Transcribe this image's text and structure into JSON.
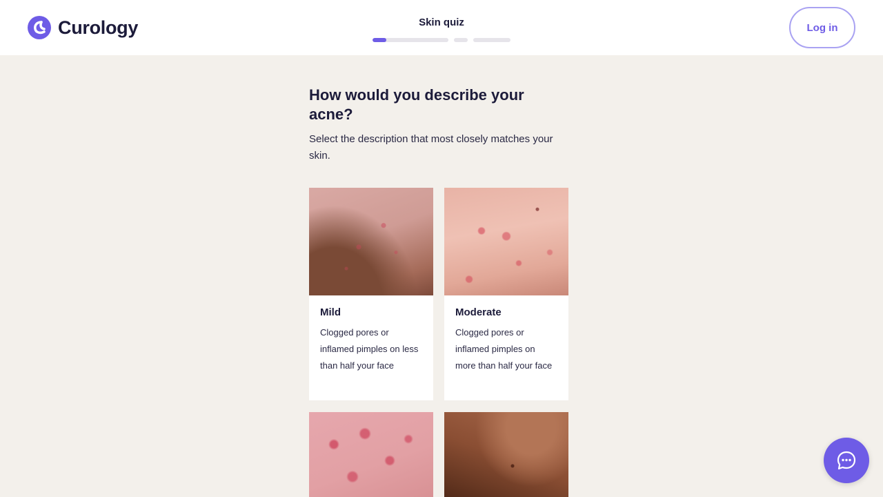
{
  "brand": {
    "name": "Curology",
    "accent": "#6e5ce6"
  },
  "header": {
    "quiz_title": "Skin quiz",
    "progress_fraction_first_segment": 0.18,
    "login_label": "Log in"
  },
  "question": {
    "title": "How would you describe your acne?",
    "subtitle": "Select the description that most closely matches your skin."
  },
  "options": [
    {
      "title": "Mild",
      "description": "Clogged pores or inflamed pimples on less than half your face"
    },
    {
      "title": "Moderate",
      "description": "Clogged pores or inflamed pimples on more than half your face"
    },
    {
      "title": "",
      "description": ""
    },
    {
      "title": "",
      "description": ""
    }
  ],
  "chat": {
    "icon": "chat-bubble-icon"
  }
}
